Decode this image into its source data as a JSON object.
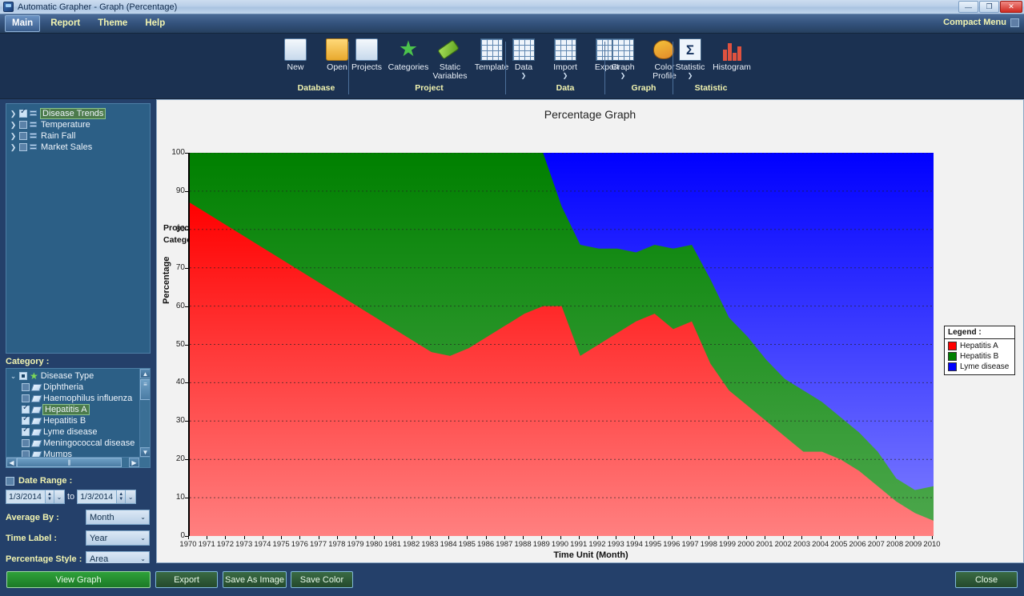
{
  "window": {
    "title": "Automatic Grapher - Graph (Percentage)",
    "app_icon": "app-icon",
    "minimize": "—",
    "restore": "❐",
    "close": "✕"
  },
  "menubar": {
    "items": [
      {
        "label": "Main",
        "active": true
      },
      {
        "label": "Report",
        "active": false
      },
      {
        "label": "Theme",
        "active": false
      },
      {
        "label": "Help",
        "active": false
      }
    ],
    "compact_menu": "Compact Menu"
  },
  "ribbon": {
    "groups": [
      {
        "name": "Database",
        "items": [
          {
            "label": "New",
            "icon": "new-document-icon",
            "dropdown": false
          },
          {
            "label": "Open",
            "icon": "open-folder-icon",
            "dropdown": false
          }
        ]
      },
      {
        "name": "Project",
        "items": [
          {
            "label": "Projects",
            "icon": "projects-icon",
            "dropdown": false
          },
          {
            "label": "Categories",
            "icon": "star-icon",
            "dropdown": false
          },
          {
            "label": "Static Variables",
            "icon": "tag-icon",
            "dropdown": false
          },
          {
            "label": "Template",
            "icon": "template-icon",
            "dropdown": false
          }
        ]
      },
      {
        "name": "Data",
        "items": [
          {
            "label": "Data",
            "icon": "table-icon",
            "dropdown": true
          },
          {
            "label": "Import",
            "icon": "import-icon",
            "dropdown": true
          },
          {
            "label": "Export",
            "icon": "export-icon",
            "dropdown": false
          }
        ]
      },
      {
        "name": "Graph",
        "items": [
          {
            "label": "Graph",
            "icon": "graph-icon",
            "dropdown": true
          },
          {
            "label": "Color Profile",
            "icon": "palette-icon",
            "dropdown": false
          }
        ]
      },
      {
        "name": "Statistic",
        "items": [
          {
            "label": "Statistic",
            "icon": "sigma-icon",
            "dropdown": true
          },
          {
            "label": "Histogram",
            "icon": "histogram-icon",
            "dropdown": false
          }
        ]
      }
    ]
  },
  "project_tree": {
    "items": [
      {
        "label": "Disease Trends",
        "checked": true,
        "selected": true
      },
      {
        "label": "Temperature",
        "checked": false,
        "selected": false
      },
      {
        "label": "Rain Fall",
        "checked": false,
        "selected": false
      },
      {
        "label": "Market Sales",
        "checked": false,
        "selected": false
      }
    ]
  },
  "category": {
    "label": "Category :",
    "root": {
      "label": "Disease Type",
      "state": "mixed"
    },
    "items": [
      {
        "label": "Diphtheria",
        "checked": false,
        "selected": false
      },
      {
        "label": "Haemophilus influenza",
        "checked": false,
        "selected": false
      },
      {
        "label": "Hepatitis A",
        "checked": true,
        "selected": true
      },
      {
        "label": "Hepatitis B",
        "checked": true,
        "selected": false
      },
      {
        "label": "Lyme disease",
        "checked": true,
        "selected": false
      },
      {
        "label": "Meningococcal disease",
        "checked": false,
        "selected": false
      },
      {
        "label": "Mumps",
        "checked": false,
        "selected": false
      }
    ]
  },
  "options": {
    "date_range_label": "Date Range :",
    "date_range_checked": false,
    "date_from": "1/3/2014",
    "date_to": "1/3/2014",
    "to_label": "to",
    "average_by_label": "Average By :",
    "average_by_value": "Month",
    "time_label_label": "Time Label :",
    "time_label_value": "Year",
    "percentage_style_label": "Percentage Style :",
    "percentage_style_value": "Area"
  },
  "footer": {
    "view_graph": "View Graph",
    "export": "Export",
    "save_as_image": "Save As Image",
    "save_color": "Save Color",
    "close": "Close"
  },
  "chart_info": {
    "project_label": "Project :",
    "project_value": "Disease Trends",
    "category_label": "Category :",
    "category_value": "Disease Type",
    "legend_title": "Legend :"
  },
  "chart_data": {
    "type": "area",
    "title": "Percentage Graph",
    "xlabel": "Time Unit (Month)",
    "ylabel": "Percentage",
    "ylim": [
      0,
      100
    ],
    "yticks": [
      0,
      10,
      20,
      30,
      40,
      50,
      60,
      70,
      80,
      90,
      100
    ],
    "grid": true,
    "legend_position": "right",
    "stacked": true,
    "colors": {
      "Hepatitis A": "#ff0000",
      "Hepatitis B": "#008000",
      "Lyme disease": "#0000ff"
    },
    "categories": [
      1970,
      1971,
      1972,
      1973,
      1974,
      1975,
      1976,
      1977,
      1978,
      1979,
      1980,
      1981,
      1982,
      1983,
      1984,
      1985,
      1986,
      1987,
      1988,
      1989,
      1990,
      1991,
      1992,
      1993,
      1994,
      1995,
      1996,
      1997,
      1998,
      1999,
      2000,
      2001,
      2002,
      2003,
      2004,
      2005,
      2006,
      2007,
      2008,
      2009,
      2010
    ],
    "series": [
      {
        "name": "Hepatitis A",
        "values": [
          87,
          84,
          81,
          78,
          75,
          72,
          69,
          66,
          63,
          60,
          57,
          54,
          51,
          48,
          47,
          49,
          52,
          55,
          58,
          60,
          60,
          47,
          50,
          53,
          56,
          58,
          54,
          56,
          45,
          38,
          34,
          30,
          26,
          22,
          22,
          20,
          17,
          13,
          9,
          6,
          4
        ]
      },
      {
        "name": "Hepatitis B",
        "values": [
          13,
          16,
          19,
          22,
          25,
          28,
          31,
          34,
          37,
          40,
          43,
          46,
          49,
          52,
          53,
          51,
          48,
          45,
          42,
          40,
          26,
          29,
          25,
          22,
          18,
          18,
          21,
          20,
          22,
          19,
          18,
          16,
          15,
          16,
          13,
          11,
          10,
          9,
          6,
          6,
          9
        ]
      },
      {
        "name": "Lyme disease",
        "values": [
          0,
          0,
          0,
          0,
          0,
          0,
          0,
          0,
          0,
          0,
          0,
          0,
          0,
          0,
          0,
          0,
          0,
          0,
          0,
          0,
          14,
          24,
          25,
          25,
          26,
          24,
          25,
          24,
          33,
          43,
          48,
          54,
          59,
          62,
          65,
          69,
          73,
          78,
          85,
          88,
          87
        ]
      }
    ]
  }
}
